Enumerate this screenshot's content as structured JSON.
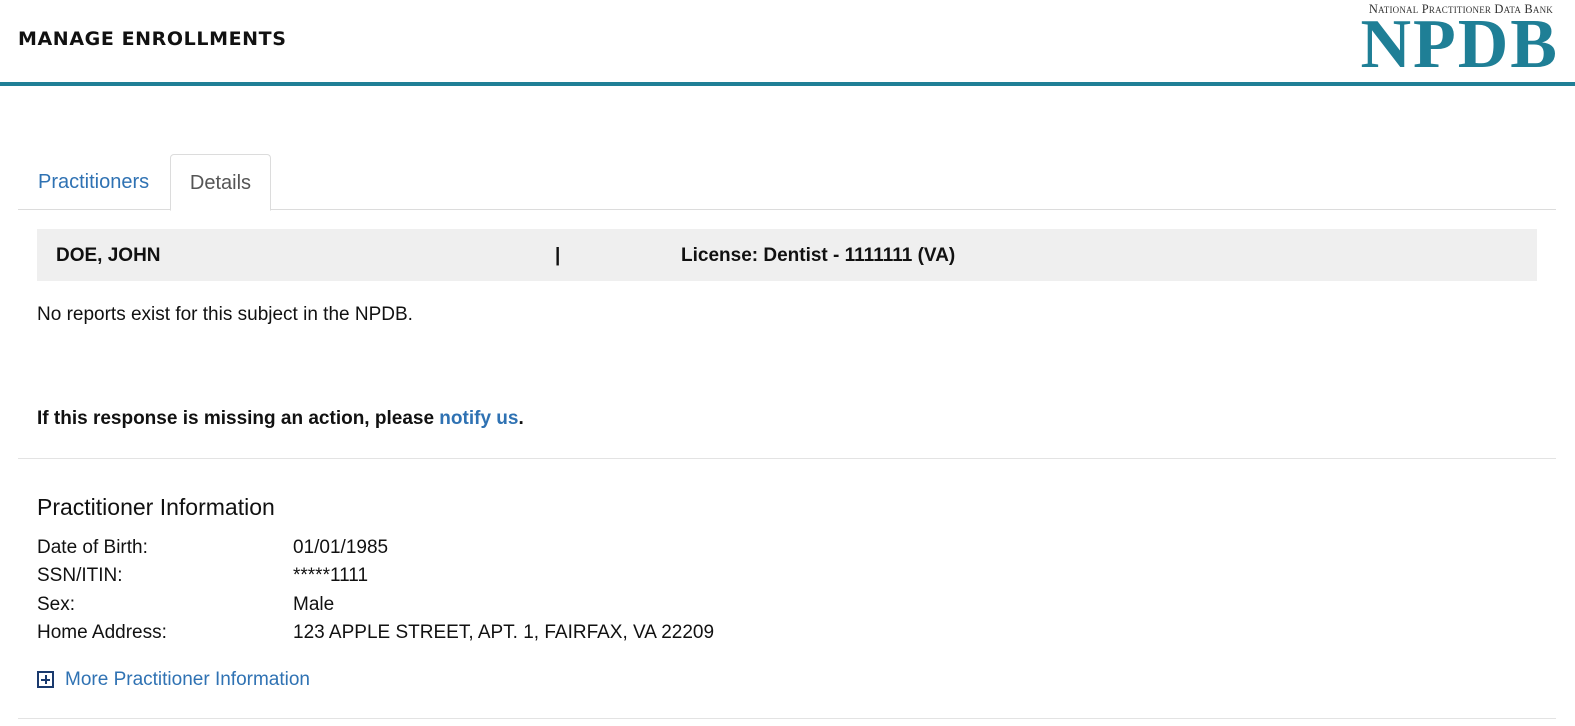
{
  "header": {
    "title": "MANAGE ENROLLMENTS",
    "logo_top": "National Practitioner Data Bank",
    "logo_main": "NPDB"
  },
  "tabs": [
    {
      "label": "Practitioners",
      "active": false
    },
    {
      "label": "Details",
      "active": true
    }
  ],
  "subject": {
    "name": "DOE, JOHN",
    "separator": "|",
    "license": "License: Dentist - 1111111 (VA)"
  },
  "messages": {
    "no_reports": "No reports exist for this subject in the NPDB.",
    "missing_prefix": "If this response is missing an action, please ",
    "missing_link": "notify us",
    "missing_suffix": "."
  },
  "practitioner_info": {
    "title": "Practitioner Information",
    "rows": [
      {
        "label": "Date of Birth:",
        "value": "01/01/1985"
      },
      {
        "label": "SSN/ITIN:",
        "value": "*****1111"
      },
      {
        "label": "Sex:",
        "value": "Male"
      },
      {
        "label": "Home Address:",
        "value": "123 APPLE STREET, APT. 1, FAIRFAX, VA 22209"
      }
    ],
    "more_label": "More Practitioner Information",
    "more_icon": "plus-box-icon"
  },
  "colors": {
    "brand": "#1f7f96",
    "link": "#2f72b3",
    "bar_bg": "#efefef"
  }
}
